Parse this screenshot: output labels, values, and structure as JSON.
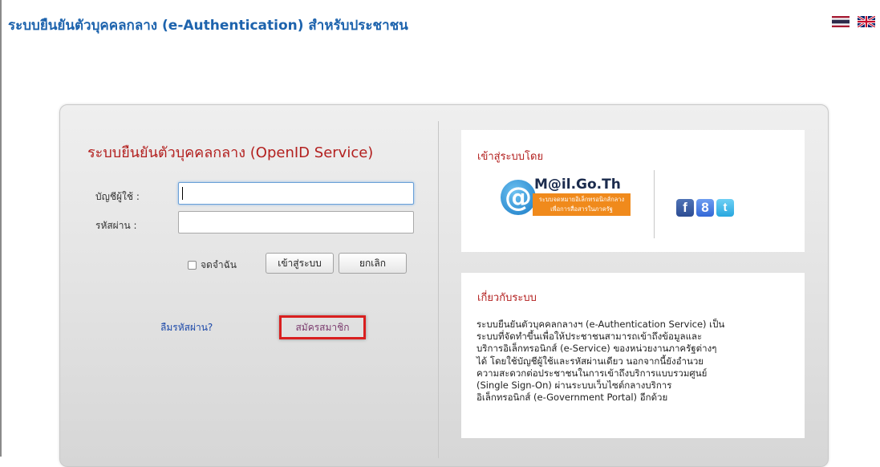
{
  "header": {
    "title": "ระบบยืนยันตัวบุคคลกลาง (e-Authentication) สำหรับประชาชน",
    "flags": [
      {
        "icon": "thai-flag-icon"
      },
      {
        "icon": "uk-flag-icon"
      }
    ]
  },
  "login": {
    "title": "ระบบยืนยันตัวบุคคลกลาง (OpenID Service)",
    "username_label": "บัญชีผู้ใช้ :",
    "username_value": "",
    "password_label": "รหัสผ่าน :",
    "password_value": "",
    "remember_label": "จดจำฉัน",
    "login_button": "เข้าสู่ระบบ",
    "cancel_button": "ยกเลิก",
    "forgot_link": "ลืมรหัสผ่าน?",
    "register_link": "สมัครสมาชิก"
  },
  "login_via": {
    "title": "เข้าสู่ระบบโดย",
    "mail_logo": {
      "name": "M@il.Go.Th",
      "tagline_line1": "ระบบจดหมายอิเล็กทรอนิกส์กลาง",
      "tagline_line2": "เพื่อการสื่อสารในภาครัฐ"
    },
    "social": [
      {
        "icon": "facebook-icon",
        "glyph": "f"
      },
      {
        "icon": "google-plus-icon",
        "glyph": "8"
      },
      {
        "icon": "twitter-icon",
        "glyph": "t"
      }
    ]
  },
  "about": {
    "title": "เกี่ยวกับระบบ",
    "lines": [
      "ระบบยืนยันตัวบุคคลกลางฯ (e-Authentication Service) เป็น",
      "ระบบที่จัดทำขึ้นเพื่อให้ประชาชนสามารถเข้าถึงข้อมูลและ",
      "บริการอิเล็กทรอนิกส์ (e-Service) ของหน่วยงานภาครัฐต่างๆ",
      "ได้ โดยใช้บัญชีผู้ใช้และรหัสผ่านเดียว นอกจากนี้ยังอำนวย",
      "ความสะดวกต่อประชาชนในการเข้าถึงบริการแบบรวมศูนย์",
      "(Single Sign-On) ผ่านระบบเว็บไซต์กลางบริการ",
      "อิเล็กทรอนิกส์ (e-Government Portal) อีกด้วย"
    ]
  },
  "colors": {
    "header_blue": "#1d63ad",
    "title_red": "#b3201f",
    "highlight_red": "#d91f1f",
    "link_blue": "#1a47a8"
  }
}
